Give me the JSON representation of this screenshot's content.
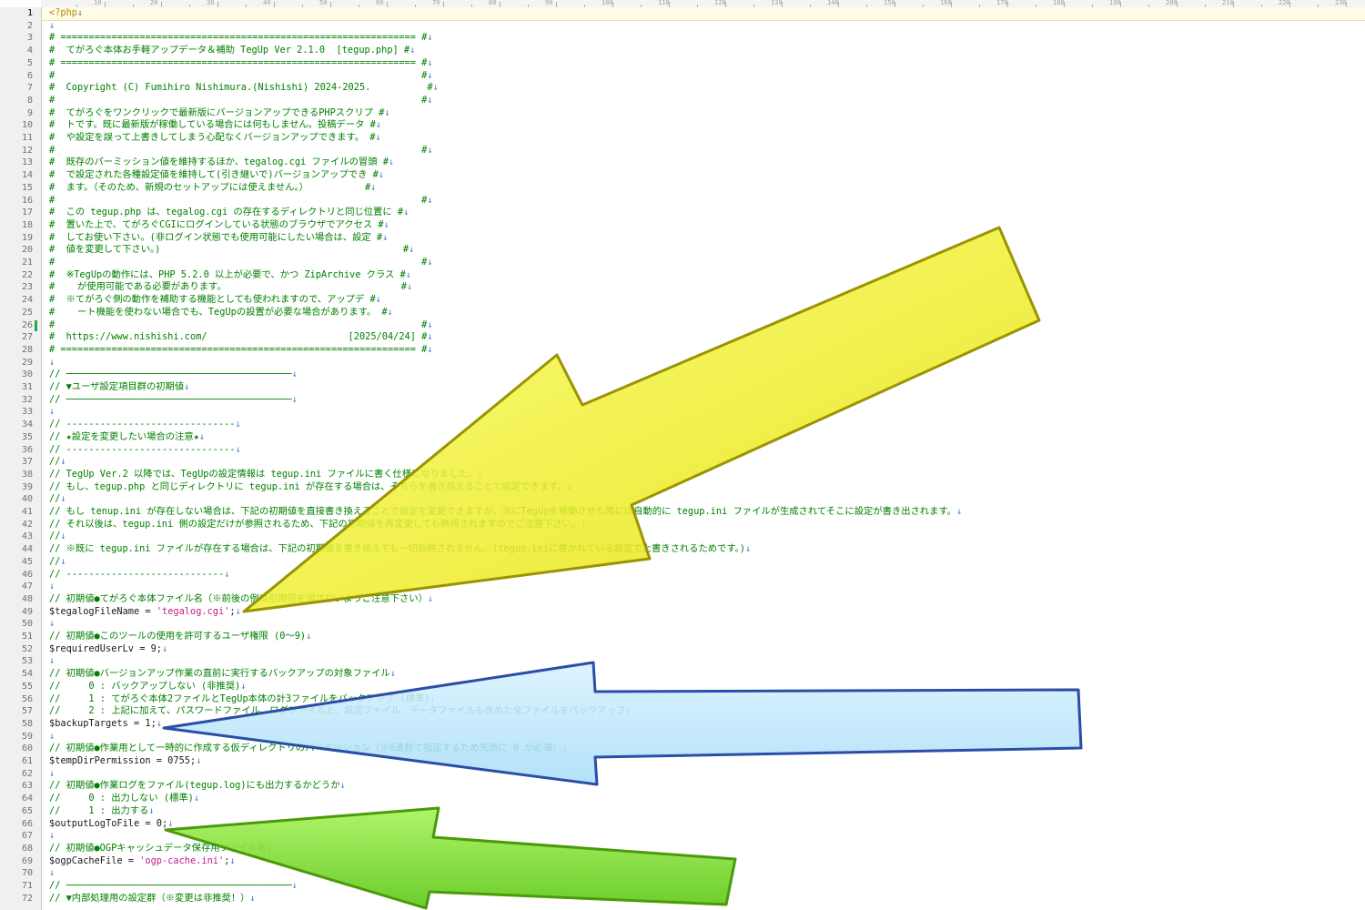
{
  "editor": {
    "lines": [
      [
        {
          "t": "<?php",
          "c": "php"
        }
      ],
      [],
      [
        {
          "t": "# =============================================================== #"
        }
      ],
      [
        {
          "t": "#  てがろぐ本体お手軽アップデータ＆補助 TegUp Ver 2.1.0  [tegup.php] #"
        }
      ],
      [
        {
          "t": "# =============================================================== #"
        }
      ],
      [
        {
          "t": "#                                                                 #"
        }
      ],
      [
        {
          "t": "#  Copyright (C) Fumihiro Nishimura.(Nishishi) 2024-2025.          #"
        }
      ],
      [
        {
          "t": "#                                                                 #"
        }
      ],
      [
        {
          "t": "#  てがろぐをワンクリックで最新版にバージョンアップできるPHPスクリプ #"
        }
      ],
      [
        {
          "t": "#  トです。既に最新版が稼働している場合には何もしません。投稿データ #"
        }
      ],
      [
        {
          "t": "#  や設定を誤って上書きしてしまう心配なくバージョンアップできます。 #"
        }
      ],
      [
        {
          "t": "#                                                                 #"
        }
      ],
      [
        {
          "t": "#  既存のパーミッション値を維持するほか、tegalog.cgi ファイルの冒頭 #"
        }
      ],
      [
        {
          "t": "#  で設定された各種設定値を維持して(引き継いで)バージョンアップでき #"
        }
      ],
      [
        {
          "t": "#  ます。（そのため、新規のセットアップには使えません。）          #"
        }
      ],
      [
        {
          "t": "#                                                                 #"
        }
      ],
      [
        {
          "t": "#  この tegup.php は、tegalog.cgi の存在するディレクトリと同じ位置に #"
        }
      ],
      [
        {
          "t": "#  置いた上で、てがろぐCGIにログインしている状態のブラウザでアクセス #"
        }
      ],
      [
        {
          "t": "#  してお使い下さい。(非ログイン状態でも使用可能にしたい場合は、設定 #"
        }
      ],
      [
        {
          "t": "#  値を変更して下さい。)                                           #"
        }
      ],
      [
        {
          "t": "#                                                                 #"
        }
      ],
      [
        {
          "t": "#  ※TegUpの動作には、PHP 5.2.0 以上が必要で、かつ ZipArchive クラス #"
        }
      ],
      [
        {
          "t": "#    が使用可能である必要があります。                               #"
        }
      ],
      [
        {
          "t": "#  ※てがろぐ側の動作を補助する機能としても使われますので、アップデ #"
        }
      ],
      [
        {
          "t": "#    ート機能を使わない場合でも、TegUpの設置が必要な場合があります。 #"
        }
      ],
      [
        {
          "t": "#                                                                 #"
        }
      ],
      [
        {
          "t": "#  https://www.nishishi.com/                         [2025/04/24] #"
        }
      ],
      [
        {
          "t": "# =============================================================== #"
        }
      ],
      [],
      [
        {
          "t": "// ────────────────────────────────────────"
        }
      ],
      [
        {
          "t": "// ▼ユーザ設定項目群の初期値"
        }
      ],
      [
        {
          "t": "// ────────────────────────────────────────"
        }
      ],
      [],
      [
        {
          "t": "// ------------------------------"
        }
      ],
      [
        {
          "t": "// ★設定を変更したい場合の注意★"
        }
      ],
      [
        {
          "t": "// ------------------------------"
        }
      ],
      [
        {
          "t": "//"
        }
      ],
      [
        {
          "t": "// TegUp Ver.2 以降では、TegUpの設定情報は tegup.ini ファイルに書く仕様になりました。"
        }
      ],
      [
        {
          "t": "// もし、tegup.php と同じディレクトリに tegup.ini が存在する場合は、そちらを書き換えることで設定できます。"
        }
      ],
      [
        {
          "t": "//"
        }
      ],
      [
        {
          "t": "// もし tenup.ini が存在しない場合は、下記の初期値を直接書き換えることで設定を変更できますが、次にTegUpを稼働させた際には自動的に tegup.ini ファイルが生成されてそこに設定が書き出されます。"
        }
      ],
      [
        {
          "t": "// それ以後は、tegup.ini 側の設定だけが参照されるため、下記の初期値を再変更しても無視されますのでご注意下さい。"
        }
      ],
      [
        {
          "t": "//"
        }
      ],
      [
        {
          "t": "// ※既に tegup.ini ファイルが存在する場合は、下記の初期値を書き換えても一切反映されません。(tegup.iniに書かれている設定で上書きされるためです。)"
        }
      ],
      [
        {
          "t": "//"
        }
      ],
      [
        {
          "t": "// ----------------------------"
        }
      ],
      [],
      [
        {
          "t": "// 初期値●てがろぐ本体ファイル名（※前後の例は引用符を消さないようご注意下さい）"
        }
      ],
      [
        {
          "t": "$tegalogFileName = ",
          "c": "var"
        },
        {
          "t": "'tegalog.cgi'",
          "c": "str"
        },
        {
          "t": ";",
          "c": "var"
        }
      ],
      [],
      [
        {
          "t": "// 初期値●このツールの使用を許可するユーザ権限 (0〜9)"
        }
      ],
      [
        {
          "t": "$requiredUserLv = 9;",
          "c": "var"
        }
      ],
      [],
      [
        {
          "t": "// 初期値●バージョンアップ作業の直前に実行するバックアップの対象ファイル"
        }
      ],
      [
        {
          "t": "//     0 : バックアップしない (非推奨)"
        }
      ],
      [
        {
          "t": "//     1 : てがろぐ本体2ファイルとTegUp本体の計3ファイルをバックアップ (標準)"
        }
      ],
      [
        {
          "t": "//     2 : 上記に加えて、パスワードファイル、ログファイルと、設定ファイル、データファイルも含めた全ファイルをバックアップ"
        }
      ],
      [
        {
          "t": "$backupTargets = 1;",
          "c": "var"
        }
      ],
      [],
      [
        {
          "t": "// 初期値●作業用として一時的に作成する仮ディレクトリのパーミッション（※8進数で指定するため先頭に 0 が必須）"
        }
      ],
      [
        {
          "t": "$tempDirPermission = 0755;",
          "c": "var"
        }
      ],
      [],
      [
        {
          "t": "// 初期値●作業ログをファイル(tegup.log)にも出力するかどうか"
        }
      ],
      [
        {
          "t": "//     0 : 出力しない (標準)"
        }
      ],
      [
        {
          "t": "//     1 : 出力する"
        }
      ],
      [
        {
          "t": "$outputLogToFile = 0;",
          "c": "var"
        }
      ],
      [],
      [
        {
          "t": "// 初期値●OGPキャッシュデータ保存用ファイル名"
        }
      ],
      [
        {
          "t": "$ogpCacheFile = ",
          "c": "var"
        },
        {
          "t": "'ogp-cache.ini'",
          "c": "str"
        },
        {
          "t": ";",
          "c": "var"
        }
      ],
      [],
      [
        {
          "t": "// ────────────────────────────────────────"
        }
      ],
      [
        {
          "t": "// ▼内部処理用の設定群（※変更は非推奨！）"
        }
      ]
    ],
    "eol_mark": "↓",
    "current_line": 1,
    "modified_line": 26
  },
  "ruler": {
    "labels": [
      "10",
      "20",
      "30",
      "40",
      "50",
      "60",
      "70",
      "80",
      "90",
      "100",
      "110",
      "120",
      "130",
      "140",
      "150",
      "160",
      "170",
      "180",
      "190",
      "200",
      "210",
      "220",
      "230",
      "240"
    ]
  },
  "colors": {
    "comment": "#008000",
    "eol": "#4a78d0",
    "string": "#c0208c",
    "arrow_yellow": "#f2f020",
    "arrow_blue": "#bfe6fb",
    "arrow_green": "#7fe02a"
  }
}
